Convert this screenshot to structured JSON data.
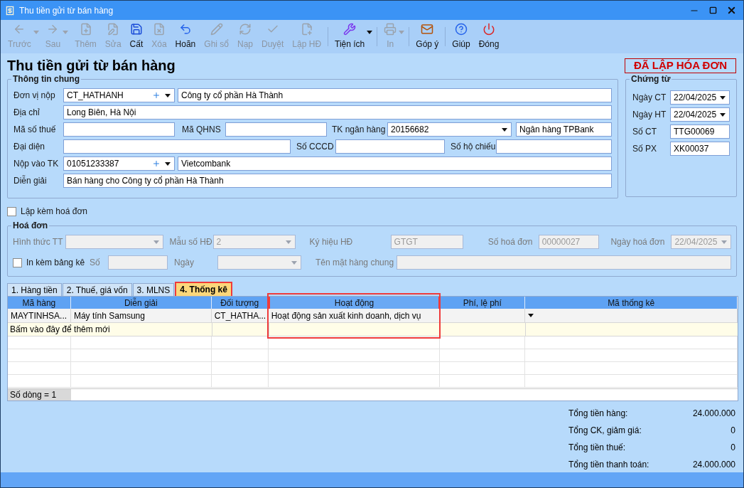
{
  "window": {
    "title": "Thu tiền gửi từ bán hàng"
  },
  "toolbar": [
    {
      "kind": "button",
      "label": "Trước",
      "disabled": true,
      "dropdown": true
    },
    {
      "kind": "button",
      "label": "Sau",
      "disabled": true,
      "dropdown": true
    },
    {
      "kind": "button",
      "label": "Thêm",
      "disabled": true,
      "dropdown": false
    },
    {
      "kind": "button",
      "label": "Sửa",
      "disabled": true,
      "dropdown": false
    },
    {
      "kind": "button",
      "label": "Cất",
      "disabled": false,
      "dropdown": false
    },
    {
      "kind": "button",
      "label": "Xóa",
      "disabled": true,
      "dropdown": false
    },
    {
      "kind": "button",
      "label": "Hoãn",
      "disabled": false,
      "dropdown": false
    },
    {
      "kind": "button",
      "label": "Ghi sổ",
      "disabled": true,
      "dropdown": false
    },
    {
      "kind": "button",
      "label": "Nạp",
      "disabled": true,
      "dropdown": false
    },
    {
      "kind": "button",
      "label": "Duyệt",
      "disabled": true,
      "dropdown": false
    },
    {
      "kind": "button",
      "label": "Lập HĐ",
      "disabled": true,
      "dropdown": false
    },
    {
      "kind": "separator"
    },
    {
      "kind": "button",
      "label": "Tiện ích",
      "disabled": false,
      "dropdown": true
    },
    {
      "kind": "separator"
    },
    {
      "kind": "button",
      "label": "In",
      "disabled": true,
      "dropdown": true
    },
    {
      "kind": "separator"
    },
    {
      "kind": "button",
      "label": "Góp ý",
      "disabled": false,
      "dropdown": false
    },
    {
      "kind": "separator"
    },
    {
      "kind": "button",
      "label": "Giúp",
      "disabled": false,
      "dropdown": false
    },
    {
      "kind": "button",
      "label": "Đóng",
      "disabled": false,
      "dropdown": false
    }
  ],
  "heading": "Thu tiền gửi từ bán hàng",
  "status_stamp": "ĐÃ LẬP HÓA ĐƠN",
  "general": {
    "title": "Thông tin chung",
    "rows": [
      [
        {
          "kind": "label",
          "text": "Đơn vị nộp"
        },
        {
          "kind": "lookup",
          "value": "CT_HATHANH"
        },
        {
          "kind": "input",
          "value": "Công ty cổ phần Hà Thành"
        }
      ],
      [
        {
          "kind": "label",
          "text": "Địa chỉ"
        },
        {
          "kind": "input",
          "value": "Long Biên, Hà Nội"
        }
      ],
      [
        {
          "kind": "label",
          "text": "Mã số thuế"
        },
        {
          "kind": "input"
        },
        {
          "kind": "label",
          "text": "Mã QHNS"
        },
        {
          "kind": "input"
        },
        {
          "kind": "label",
          "text": "TK ngân hàng"
        },
        {
          "kind": "select",
          "value": "20156682"
        },
        {
          "kind": "input",
          "value": "Ngân hàng TPBank"
        }
      ],
      [
        {
          "kind": "label",
          "text": "Đại diện"
        },
        {
          "kind": "input"
        },
        {
          "kind": "label",
          "text": "Số CCCD"
        },
        {
          "kind": "input"
        },
        {
          "kind": "label",
          "text": "Số hộ chiếu"
        },
        {
          "kind": "input"
        }
      ],
      [
        {
          "kind": "label",
          "text": "Nộp vào TK"
        },
        {
          "kind": "lookup",
          "value": "01051233387"
        },
        {
          "kind": "input",
          "value": "Vietcombank"
        }
      ],
      [
        {
          "kind": "label",
          "text": "Diễn giải"
        },
        {
          "kind": "input",
          "value": "Bán hàng cho Công ty cổ phần Hà Thành"
        }
      ]
    ]
  },
  "voucher": {
    "title": "Chứng từ",
    "rows": [
      {
        "label": "Ngày CT",
        "kind": "select",
        "value": "22/04/2025"
      },
      {
        "label": "Ngày HT",
        "kind": "select",
        "value": "22/04/2025"
      },
      {
        "label": "Số CT",
        "kind": "input",
        "value": "TTG00069"
      },
      {
        "label": "Số PX",
        "kind": "input",
        "value": "XK00037"
      }
    ]
  },
  "attach_invoice": {
    "label": "Lập kèm hoá đơn",
    "checked": false
  },
  "invoice": {
    "title": "Hoá đơn",
    "disabled": true,
    "fields": [
      {
        "label": "Hình thức TT",
        "kind": "select"
      },
      {
        "label": "Mẫu số HĐ",
        "kind": "select",
        "value": "2"
      },
      {
        "label": "Ký hiệu HĐ",
        "kind": "input",
        "value": "GTGT"
      },
      {
        "label": "Số hoá đơn",
        "kind": "input",
        "value": "00000027"
      },
      {
        "label": "Ngày hoá đơn",
        "kind": "select",
        "value": "22/04/2025"
      },
      {
        "label": "In kèm bảng kê",
        "kind": "checkbox",
        "checked": false
      },
      {
        "label": "Số",
        "kind": "input"
      },
      {
        "label": "Ngày",
        "kind": "select"
      },
      {
        "label": "Tên mặt hàng chung",
        "kind": "input"
      }
    ]
  },
  "tabs": [
    {
      "label": "1. Hàng tiền",
      "selected": false,
      "highlighted": false
    },
    {
      "label": "2. Thuế, giá vốn",
      "selected": false,
      "highlighted": false
    },
    {
      "label": "3. MLNS",
      "selected": false,
      "highlighted": false
    },
    {
      "label": "4. Thống kê",
      "selected": true,
      "highlighted": true
    }
  ],
  "table": {
    "columns": [
      {
        "title": "Mã hàng",
        "highlighted": false
      },
      {
        "title": "Diễn giải",
        "highlighted": false
      },
      {
        "title": "Đối tượng",
        "highlighted": false
      },
      {
        "title": "Hoạt động",
        "highlighted": true
      },
      {
        "title": "Phí, lệ phí",
        "highlighted": false
      },
      {
        "title": "Mã thống kê",
        "highlighted": false
      }
    ],
    "rows": [
      {
        "selected": true,
        "cells": [
          "MAYTINHSA...",
          "Máy tính Samsung",
          "CT_HATHA...",
          "Hoạt động sản xuất kinh doanh, dịch vụ",
          null,
          null
        ]
      }
    ],
    "new_row_hint": "Bấm vào đây để thêm mới",
    "footer": "Số dòng = 1"
  },
  "totals": [
    {
      "label": "Tổng tiền hàng:",
      "value": "24.000.000"
    },
    {
      "label": "Tổng CK, giảm giá:",
      "value": "0"
    },
    {
      "label": "Tổng tiền thuế:",
      "value": "0"
    },
    {
      "label": "Tổng tiền thanh toán:",
      "value": "24.000.000"
    }
  ]
}
